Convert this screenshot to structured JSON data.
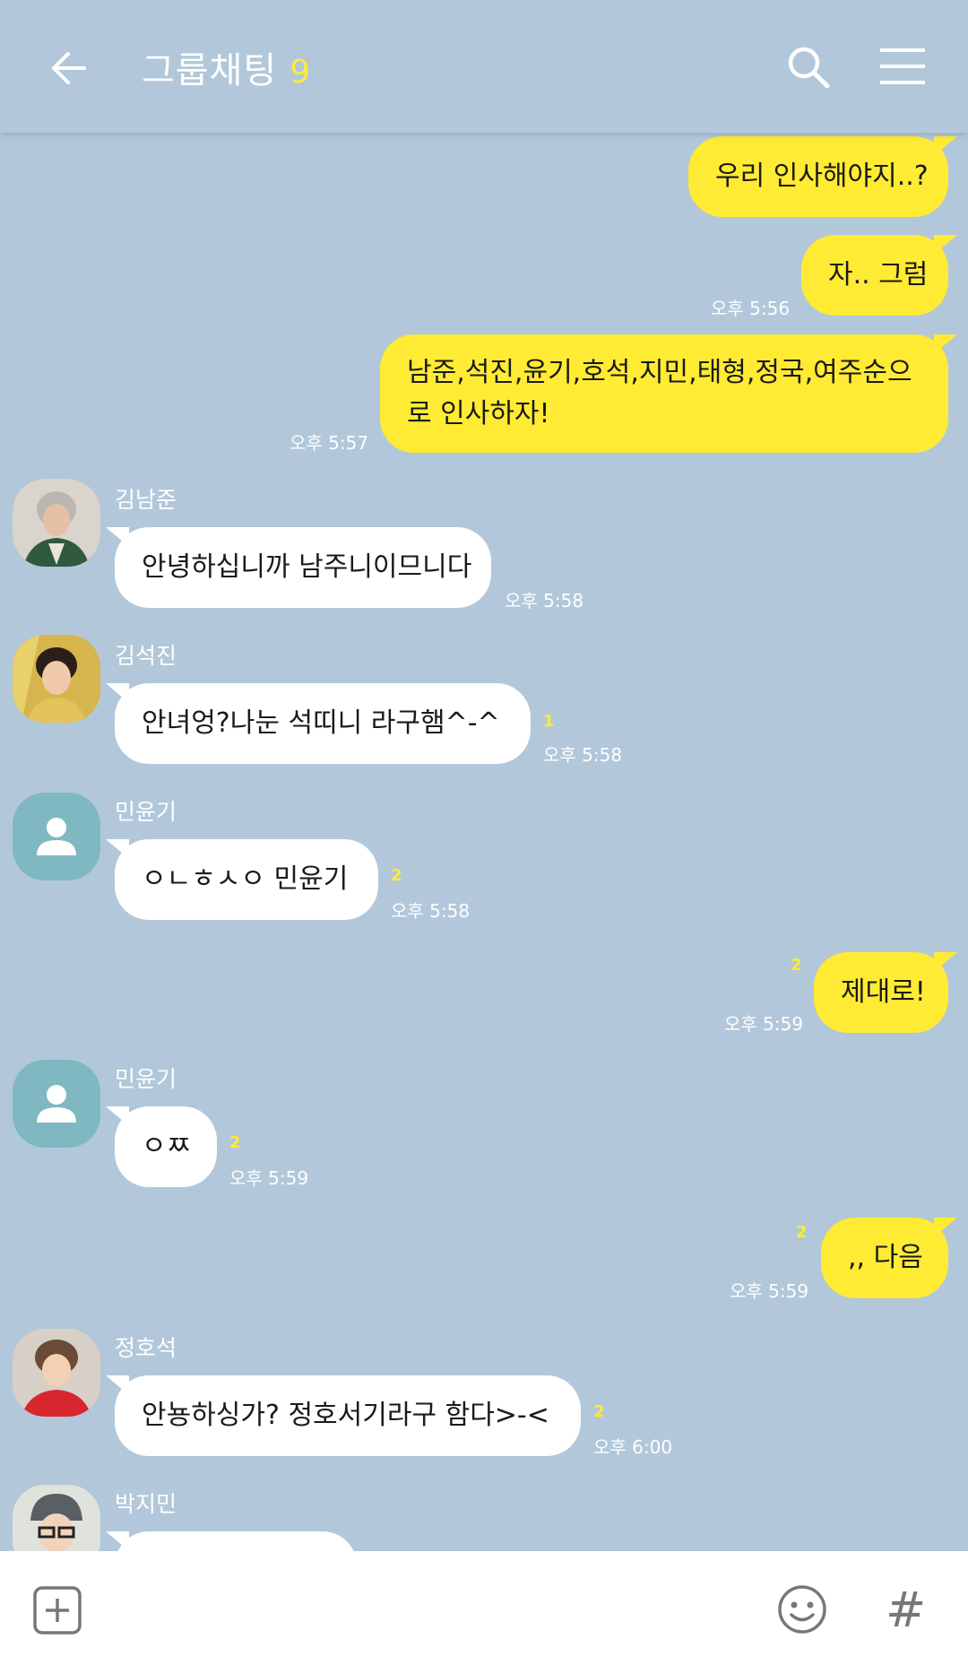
{
  "header": {
    "title": "그룹채팅",
    "member_count": "9",
    "back_icon": "arrow-left-icon",
    "search_icon": "search-icon",
    "menu_icon": "menu-icon"
  },
  "messages": [
    {
      "from": "me",
      "text": "우리 인사해야지..?",
      "time": ""
    },
    {
      "from": "me",
      "text": "자.. 그럼",
      "time": "오후 5:56"
    },
    {
      "from": "me",
      "text": "남준,석진,윤기,호석,지민,태형,정국,여주순으로 인사하자!",
      "time": "오후 5:57"
    },
    {
      "from": "김남준",
      "text": "안녕하십니까 남주니이므니다",
      "time": "오후 5:58"
    },
    {
      "from": "김석진",
      "text": "안녀엉?나눈 석띠니 라구햄^-^",
      "time": "오후 5:58",
      "unread": "1"
    },
    {
      "from": "민윤기",
      "text": "ㅇㄴㅎㅅㅇ 민윤기",
      "time": "오후 5:58",
      "unread": "2"
    },
    {
      "from": "me",
      "text": "제대로!",
      "time": "오후 5:59",
      "unread": "2"
    },
    {
      "from": "민윤기",
      "text": "ㅇㅉ",
      "time": "오후 5:59",
      "unread": "2"
    },
    {
      "from": "me",
      "text": ",, 다음",
      "time": "오후 5:59",
      "unread": "2"
    },
    {
      "from": "정호석",
      "text": "안뇽하싱가? 정호서기라구 함다>-<",
      "time": "오후 6:00",
      "unread": "2"
    },
    {
      "from": "박지민",
      "text": "",
      "time": ""
    }
  ],
  "colors": {
    "background": "#b2c7da",
    "my_bubble": "#ffeb33",
    "other_bubble": "#ffffff",
    "count": "#ffeb3b"
  },
  "bottom_bar": {
    "plus_icon": "plus-square-icon",
    "emoji_icon": "smile-icon",
    "hash_label": "#"
  }
}
